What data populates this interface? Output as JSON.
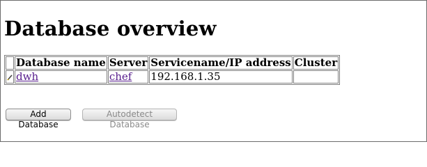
{
  "page": {
    "title": "Database overview"
  },
  "table": {
    "headers": [
      "Database name",
      "Server",
      "Servicename/IP address",
      "Cluster"
    ],
    "rows": [
      {
        "icon": "edit-icon",
        "database_name": "dwh",
        "server": "chef",
        "service_ip": "192.168.1.35",
        "cluster": ""
      }
    ]
  },
  "actions": {
    "add_label": "Add Database",
    "autodetect_label": "Autodetect Database",
    "autodetect_disabled": true
  },
  "colors": {
    "link": "#551a8b",
    "border": "#808080",
    "disabled_text": "#8a8a8a"
  }
}
